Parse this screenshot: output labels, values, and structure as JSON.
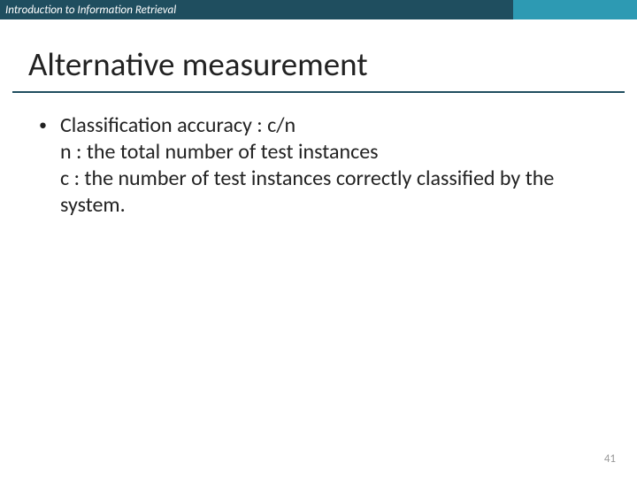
{
  "header": {
    "title": "Introduction to Information Retrieval"
  },
  "slide": {
    "title": "Alternative measurement",
    "bullet_marker": "•",
    "line1": "Classification accuracy : c/n",
    "line2": "n : the total number of test instances",
    "line3": "c : the number of test instances correctly classified by the system."
  },
  "page_number": "41"
}
